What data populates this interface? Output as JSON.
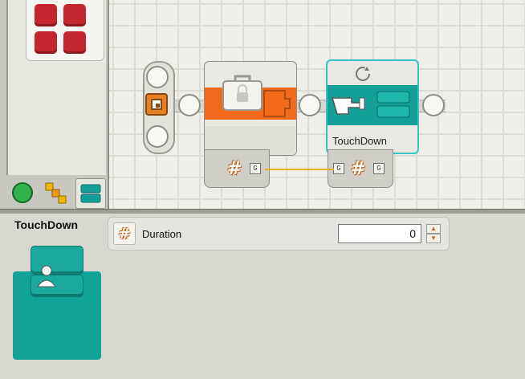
{
  "program": {
    "blocks": [
      {
        "name": "wait-block",
        "type": "wait"
      },
      {
        "name": "touch-block",
        "label": "TouchDown"
      }
    ]
  },
  "config_panel": {
    "title": "TouchDown",
    "parameter": {
      "label": "Duration",
      "value": "0"
    }
  },
  "icons": {
    "palette_tabs": [
      "common-palette-icon",
      "complete-palette-icon",
      "custom-palette-icon"
    ],
    "start": "start-icon",
    "wait": "lock-icon",
    "touch": "pointing-hand-icon",
    "refresh": "refresh-icon",
    "number": "hash-icon"
  },
  "colors": {
    "accent_orange": "#f06a1a",
    "accent_teal": "#14a097",
    "selection": "#3cc2c4",
    "block_red": "#c3262e",
    "wire": "#e2b21f"
  }
}
